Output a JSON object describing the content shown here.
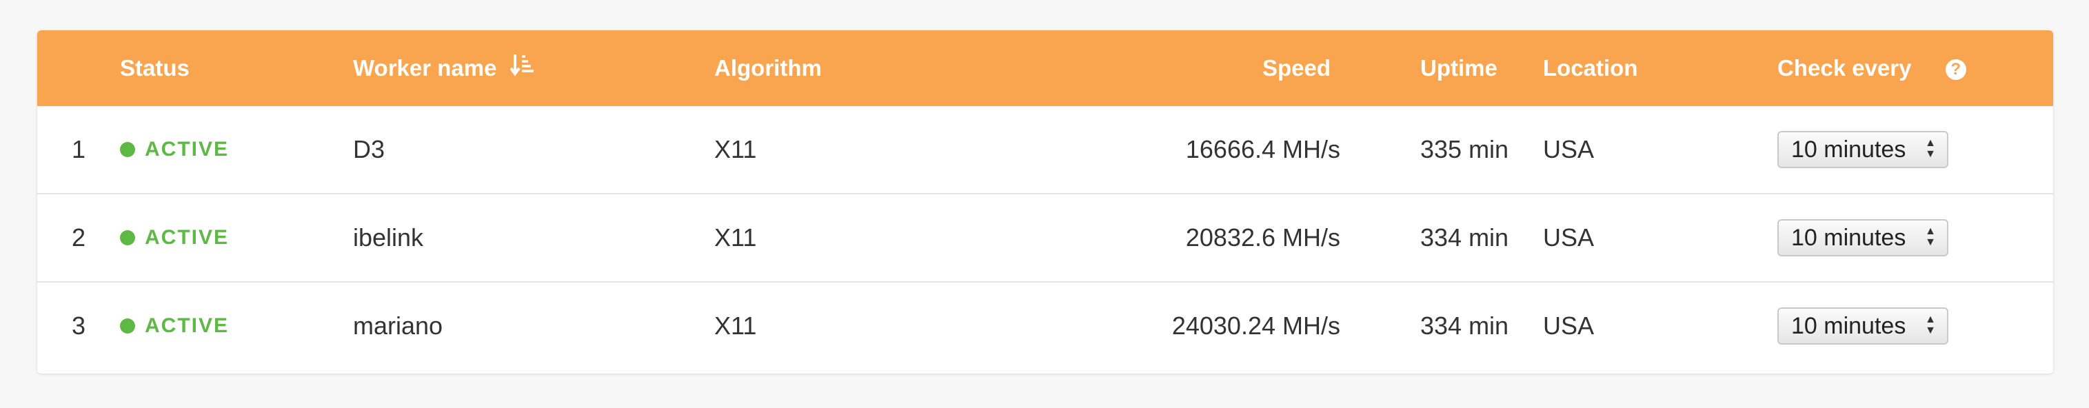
{
  "table": {
    "columns": {
      "status": "Status",
      "worker_name": "Worker name",
      "algorithm": "Algorithm",
      "speed": "Speed",
      "uptime": "Uptime",
      "location": "Location",
      "check_every": "Check every"
    },
    "help_icon": "?",
    "sort_icon": "sort-descending-icon",
    "rows": [
      {
        "index": "1",
        "status": "ACTIVE",
        "worker": "D3",
        "algorithm": "X11",
        "speed": "16666.4 MH/s",
        "uptime": "335 min",
        "location": "USA",
        "check": "10 minutes"
      },
      {
        "index": "2",
        "status": "ACTIVE",
        "worker": "ibelink",
        "algorithm": "X11",
        "speed": "20832.6 MH/s",
        "uptime": "334 min",
        "location": "USA",
        "check": "10 minutes"
      },
      {
        "index": "3",
        "status": "ACTIVE",
        "worker": "mariano",
        "algorithm": "X11",
        "speed": "24030.24 MH/s",
        "uptime": "334 min",
        "location": "USA",
        "check": "10 minutes"
      }
    ]
  },
  "colors": {
    "header_bg": "#f9a54f",
    "active": "#5db944",
    "page_bg": "#f7f7f7"
  }
}
